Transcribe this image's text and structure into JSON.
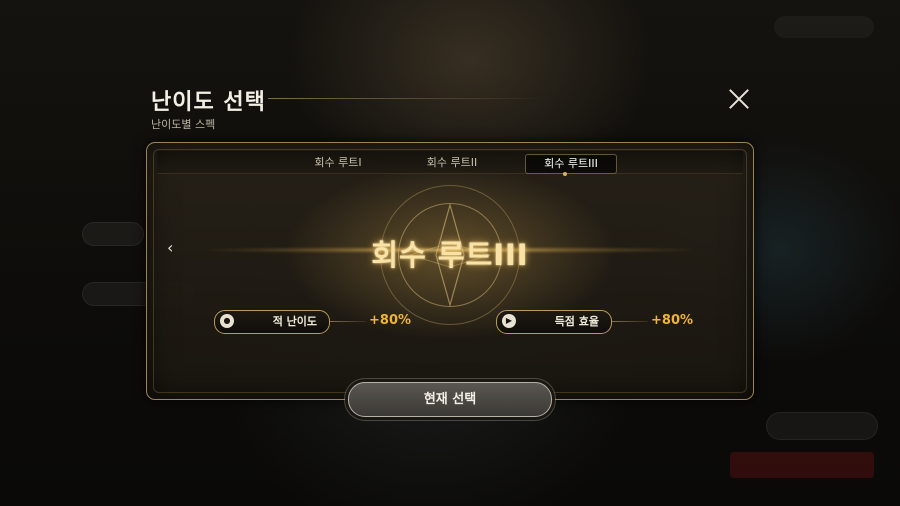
{
  "header": {
    "title": "난이도 선택",
    "subtitle": "난이도별 스펙"
  },
  "tabs": [
    {
      "label": "회수 루트I",
      "active": false
    },
    {
      "label": "회수 루트II",
      "active": false
    },
    {
      "label": "회수 루트III",
      "active": true
    }
  ],
  "route": {
    "title": "회수 루트III"
  },
  "stats": [
    {
      "label": "적 난이도",
      "value": "+80%",
      "icon": "skull-icon"
    },
    {
      "label": "득점 효율",
      "value": "+80%",
      "icon": "play-circle-icon"
    }
  ],
  "confirm_label": "현재 선택",
  "colors": {
    "accent_gold": "#f0b431",
    "frame_gold": "#9b8456"
  }
}
